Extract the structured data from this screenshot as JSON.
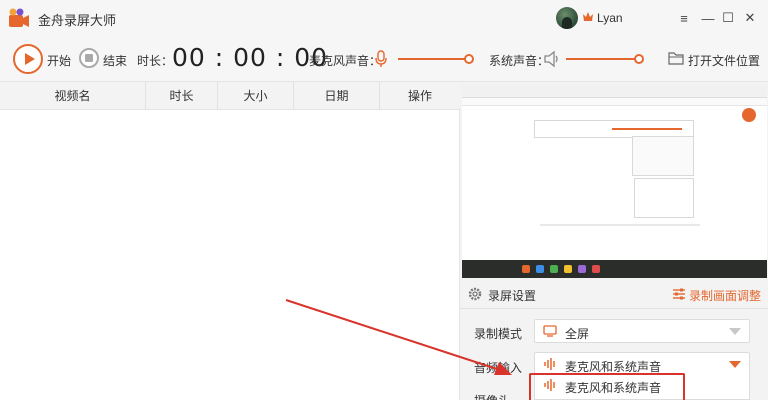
{
  "app": {
    "title": "金舟录屏大师"
  },
  "user": {
    "name": "Lyan"
  },
  "window_controls": {
    "menu": "≡",
    "minimize": "—",
    "maximize": "☐",
    "close": "✕"
  },
  "toolbar": {
    "start_label": "开始",
    "stop_label": "结束",
    "duration_label": "时长：",
    "timer": "00 : 00 : 00",
    "mic_label": "麦克风声音：",
    "mic_volume": 1.0,
    "system_label": "系统声音：",
    "system_volume": 1.0,
    "open_folder_label": "打开文件位置"
  },
  "table": {
    "columns": [
      "视频名",
      "时长",
      "大小",
      "日期",
      "操作"
    ],
    "rows": []
  },
  "settings": {
    "title": "录屏设置",
    "adjust_link": "录制画面调整",
    "record_mode": {
      "label": "录制模式",
      "value": "全屏"
    },
    "audio_input": {
      "label": "音频输入",
      "value": "麦克风和系统声音"
    },
    "camera": {
      "label": "摄像头"
    },
    "audio_options": [
      "麦克风和系统声音"
    ]
  },
  "colors": {
    "accent": "#e5672e",
    "annotation": "#d9342b"
  }
}
